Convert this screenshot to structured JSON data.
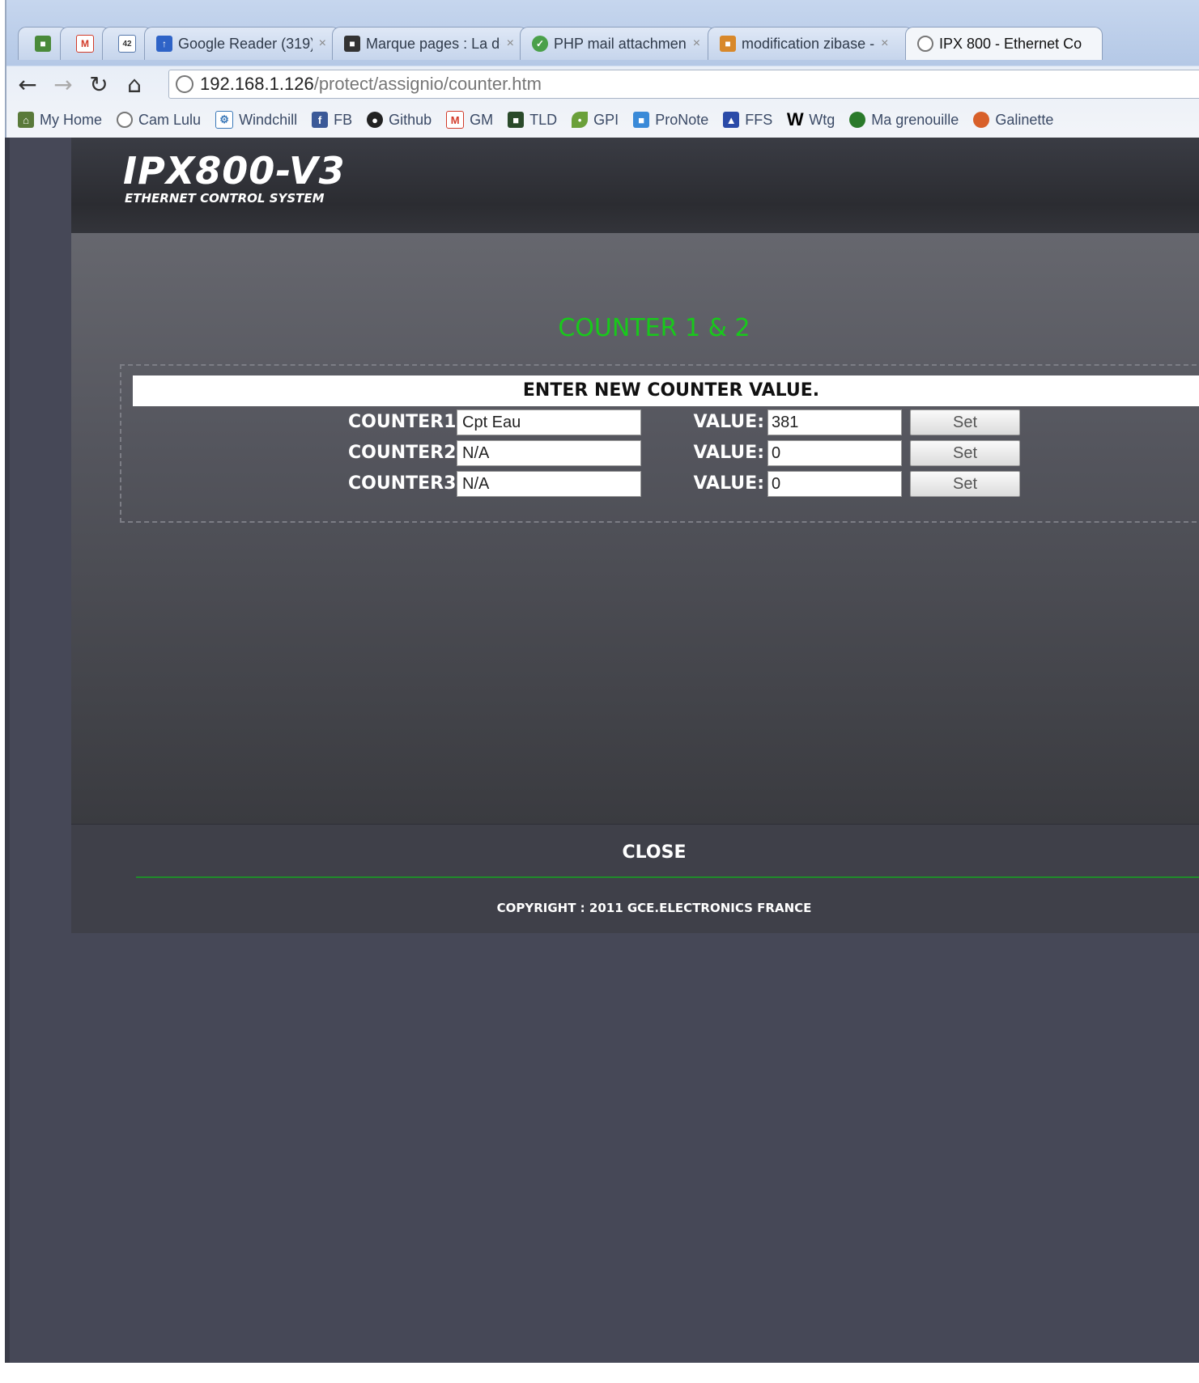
{
  "browser": {
    "tabs": [
      {
        "label": "",
        "icon": "evernote-icon",
        "color": "#4a8a3a"
      },
      {
        "label": "",
        "icon": "gmail-icon",
        "color": "#d23b2a"
      },
      {
        "label": "42",
        "icon": "calendar-icon",
        "color": "#5577aa"
      },
      {
        "label": "Google Reader (319)",
        "icon": "google-reader-icon",
        "color": "#2e63c7"
      },
      {
        "label": "Marque pages : La dc",
        "icon": "bookmark-icon",
        "color": "#333333"
      },
      {
        "label": "PHP mail attachmen",
        "icon": "php-icon",
        "color": "#4aa04a"
      },
      {
        "label": "modification zibase -",
        "icon": "zibase-icon",
        "color": "#d8882a"
      },
      {
        "label": "IPX 800 - Ethernet Co",
        "icon": "globe-icon",
        "color": "#777777"
      }
    ],
    "url_host": "192.168.1.126",
    "url_path": "/protect/assignio/counter.htm",
    "bookmarks": [
      {
        "label": "My Home",
        "icon": "home-icon",
        "color": "#5a7a3a"
      },
      {
        "label": "Cam Lulu",
        "icon": "globe-icon",
        "color": "#777777"
      },
      {
        "label": "Windchill",
        "icon": "windchill-icon",
        "color": "#3a78b8"
      },
      {
        "label": "FB",
        "icon": "facebook-icon",
        "color": "#3b5998"
      },
      {
        "label": "Github",
        "icon": "github-icon",
        "color": "#222222"
      },
      {
        "label": "GM",
        "icon": "gmail-icon",
        "color": "#d23b2a"
      },
      {
        "label": "TLD",
        "icon": "tld-icon",
        "color": "#2a4a2a"
      },
      {
        "label": "GPI",
        "icon": "leaf-icon",
        "color": "#6aa03a"
      },
      {
        "label": "ProNote",
        "icon": "pronote-icon",
        "color": "#3a8ad8"
      },
      {
        "label": "FFS",
        "icon": "ffs-icon",
        "color": "#2a4aa8"
      },
      {
        "label": "Wtg",
        "icon": "wikipedia-icon",
        "color": "#000000"
      },
      {
        "label": "Ma grenouille",
        "icon": "frog-icon",
        "color": "#2a7a2a"
      },
      {
        "label": "Galinette",
        "icon": "egg-icon",
        "color": "#d8602a"
      }
    ]
  },
  "page": {
    "logo_title": "IPX800-V3",
    "logo_subtitle": "ETHERNET CONTROL SYSTEM",
    "heading": "COUNTER 1 & 2",
    "enter_title": "ENTER NEW COUNTER VALUE.",
    "counters": [
      {
        "label": "COUNTER1:",
        "name": "Cpt Eau",
        "value_label": "VALUE:",
        "value": "381",
        "button": "Set"
      },
      {
        "label": "COUNTER2:",
        "name": "N/A",
        "value_label": "VALUE:",
        "value": "0",
        "button": "Set"
      },
      {
        "label": "COUNTER3:",
        "name": "N/A",
        "value_label": "VALUE:",
        "value": "0",
        "button": "Set"
      }
    ],
    "close_label": "CLOSE",
    "copyright": "COPYRIGHT : 2011 GCE.ELECTRONICS FRANCE"
  },
  "colors": {
    "accent_green": "#18c91b",
    "page_background": "#464857"
  }
}
